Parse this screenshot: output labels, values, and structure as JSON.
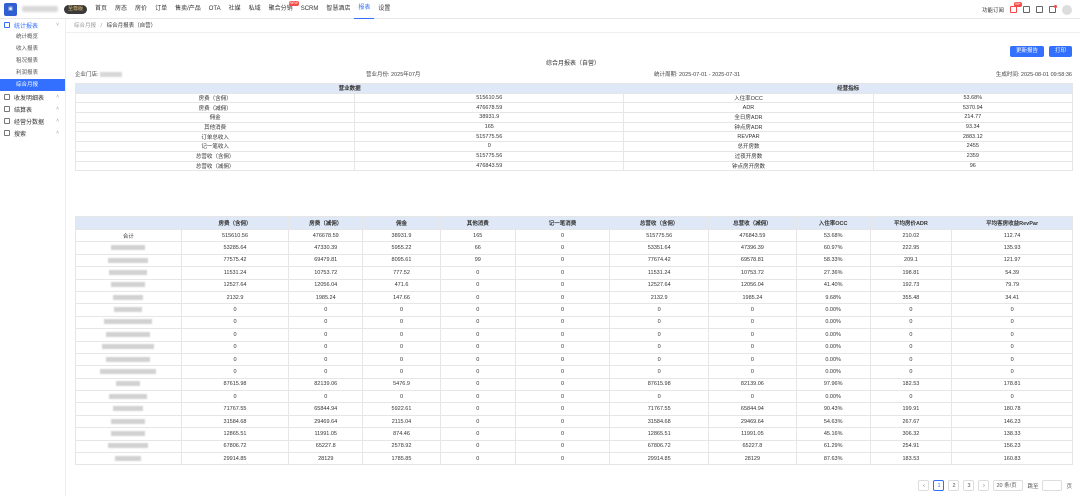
{
  "topbar": {
    "logo": "▣",
    "vip": "至尊版",
    "nav": [
      {
        "label": "首页"
      },
      {
        "label": "房态"
      },
      {
        "label": "房价"
      },
      {
        "label": "订单"
      },
      {
        "label": "售卖/产品"
      },
      {
        "label": "OTA"
      },
      {
        "label": "社媒"
      },
      {
        "label": "私域"
      },
      {
        "label": "聚合分销",
        "badge": "NEW"
      },
      {
        "label": "SCRM"
      },
      {
        "label": "智慧酒店"
      },
      {
        "label": "报表",
        "active": true
      },
      {
        "label": "设置"
      }
    ],
    "feature_label": "功能订阅",
    "msg_badge": "99+"
  },
  "sidebar": {
    "groups": [
      {
        "label": "统计报表",
        "active": true,
        "icon": "report-icon",
        "items": [
          {
            "label": "统计概览"
          },
          {
            "label": "收入报表"
          },
          {
            "label": "租况报表"
          },
          {
            "label": "利润报表"
          },
          {
            "label": "综合月报",
            "active": true
          }
        ]
      },
      {
        "label": "收发明细表",
        "icon": "list-icon"
      },
      {
        "label": "结算表",
        "icon": "settle-icon"
      },
      {
        "label": "经营分数据",
        "icon": "data-icon"
      },
      {
        "label": "搜索",
        "icon": "search-icon"
      }
    ]
  },
  "breadcrumb": {
    "parent": "综合月报",
    "sep": "/",
    "current": "综合月报表（自营）"
  },
  "buttons": {
    "refresh": "更新报告",
    "print": "打印"
  },
  "report": {
    "title": "综合月报表（自营）",
    "hotel_label": "企业门店:",
    "month_label": "营业月份: 2025年07月",
    "period_label": "统计周期: 2025-07-01 - 2025-07-31",
    "gen_label": "生成时间: 2025-08-01 09:58:36"
  },
  "summary": {
    "headers": [
      "营业数据",
      "经营指标"
    ],
    "rows": [
      [
        "房费（含佣）",
        "515610.56",
        "入住率OCC",
        "53.68%"
      ],
      [
        "房费（减佣）",
        "476678.59",
        "ADR",
        "5370.94"
      ],
      [
        "佣金",
        "38931.9",
        "全日房ADR",
        "214.77"
      ],
      [
        "其他消费",
        "165",
        "钟点房ADR",
        "93.34"
      ],
      [
        "订单总收入",
        "515775.56",
        "REVPAR",
        "2883.12"
      ],
      [
        "记一笔收入",
        "0",
        "总开房数",
        "2455"
      ],
      [
        "总营收（含佣）",
        "515775.56",
        "过夜开房数",
        "2359"
      ],
      [
        "总营收（减佣）",
        "476843.59",
        "钟点房开房数",
        "96"
      ]
    ]
  },
  "detail": {
    "headers": [
      "",
      "房费（含佣）",
      "房费（减佣）",
      "佣金",
      "其他消费",
      "记一笔消费",
      "总营收（含佣）",
      "总营收（减佣）",
      "入住率OCC",
      "平均房价ADR",
      "平均客房收益RevPar"
    ],
    "rows": [
      [
        "合计",
        "515610.56",
        "476678.59",
        "38931.9",
        "165",
        "0",
        "515775.56",
        "476843.59",
        "53.68%",
        "210.02",
        "112.74"
      ],
      [
        "",
        "53285.64",
        "47330.39",
        "5955.22",
        "66",
        "0",
        "53351.64",
        "47396.39",
        "60.97%",
        "222.95",
        "135.93"
      ],
      [
        "",
        "77575.42",
        "69479.81",
        "8095.61",
        "99",
        "0",
        "77674.42",
        "69578.81",
        "58.33%",
        "209.1",
        "121.97"
      ],
      [
        "",
        "11531.24",
        "10753.72",
        "777.52",
        "0",
        "0",
        "11531.24",
        "10753.72",
        "27.36%",
        "198.81",
        "54.39"
      ],
      [
        "",
        "12527.64",
        "12056.04",
        "471.6",
        "0",
        "0",
        "12527.64",
        "12056.04",
        "41.40%",
        "192.73",
        "79.79"
      ],
      [
        "",
        "2132.9",
        "1985.24",
        "147.66",
        "0",
        "0",
        "2132.9",
        "1985.24",
        "9.68%",
        "355.48",
        "34.41"
      ],
      [
        "",
        "0",
        "0",
        "0",
        "0",
        "0",
        "0",
        "0",
        "0.00%",
        "0",
        "0"
      ],
      [
        "",
        "0",
        "0",
        "0",
        "0",
        "0",
        "0",
        "0",
        "0.00%",
        "0",
        "0"
      ],
      [
        "",
        "0",
        "0",
        "0",
        "0",
        "0",
        "0",
        "0",
        "0.00%",
        "0",
        "0"
      ],
      [
        "",
        "0",
        "0",
        "0",
        "0",
        "0",
        "0",
        "0",
        "0.00%",
        "0",
        "0"
      ],
      [
        "",
        "0",
        "0",
        "0",
        "0",
        "0",
        "0",
        "0",
        "0.00%",
        "0",
        "0"
      ],
      [
        "",
        "0",
        "0",
        "0",
        "0",
        "0",
        "0",
        "0",
        "0.00%",
        "0",
        "0"
      ],
      [
        "",
        "87615.98",
        "82139.06",
        "5476.9",
        "0",
        "0",
        "87615.98",
        "82139.06",
        "97.96%",
        "182.53",
        "178.81"
      ],
      [
        "",
        "0",
        "0",
        "0",
        "0",
        "0",
        "0",
        "0",
        "0.00%",
        "0",
        "0"
      ],
      [
        "",
        "71767.55",
        "65844.94",
        "5922.61",
        "0",
        "0",
        "71767.55",
        "65844.94",
        "90.43%",
        "199.91",
        "180.78"
      ],
      [
        "",
        "31584.68",
        "29469.64",
        "2115.04",
        "0",
        "0",
        "31584.68",
        "29469.64",
        "54.63%",
        "267.67",
        "146.23"
      ],
      [
        "",
        "12865.51",
        "11991.05",
        "874.46",
        "0",
        "0",
        "12865.51",
        "11991.05",
        "45.16%",
        "306.32",
        "138.33"
      ],
      [
        "",
        "67806.72",
        "65227.8",
        "2578.92",
        "0",
        "0",
        "67806.72",
        "65227.8",
        "61.29%",
        "254.91",
        "156.23"
      ],
      [
        "",
        "29914.85",
        "28129",
        "1785.85",
        "0",
        "0",
        "29914.85",
        "28129",
        "87.63%",
        "183.53",
        "160.83"
      ]
    ]
  },
  "pager": {
    "prev": "‹",
    "pages": [
      "1",
      "2",
      "3"
    ],
    "current": "1",
    "next": "›",
    "size": "20 条/页",
    "jump_label": "跳至",
    "page_suffix": "页"
  }
}
